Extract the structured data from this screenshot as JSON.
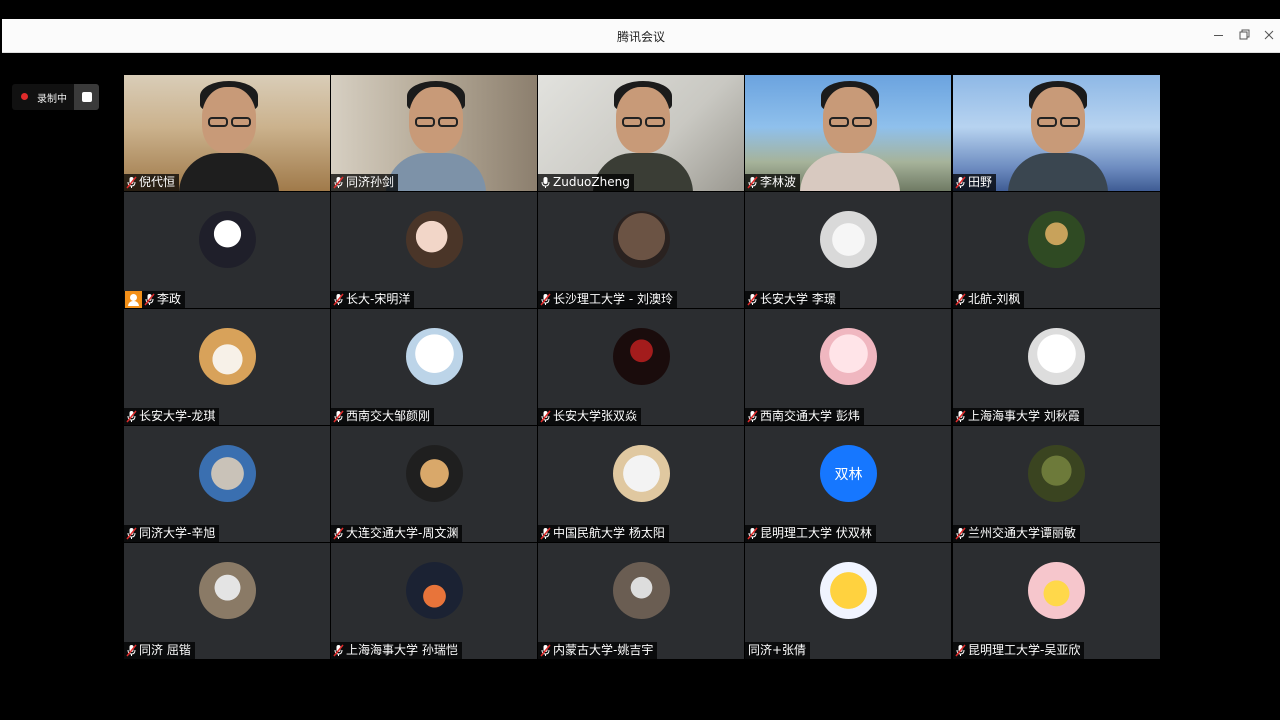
{
  "window": {
    "title": "腾讯会议",
    "controls": [
      "minimize-icon",
      "restore-icon",
      "close-icon"
    ]
  },
  "recording": {
    "label": "录制中",
    "stop_icon": "stop-square-icon",
    "status_color": "#e02b2b"
  },
  "participants": [
    {
      "name": "倪代恒",
      "type": "video",
      "muted": true
    },
    {
      "name": "同济孙剑",
      "type": "video",
      "muted": true
    },
    {
      "name": "ZuduoZheng",
      "type": "video",
      "muted": false
    },
    {
      "name": "李林波",
      "type": "video",
      "muted": true
    },
    {
      "name": "田野",
      "type": "video",
      "muted": true
    },
    {
      "name": "李政",
      "type": "avatar",
      "muted": true,
      "host": true
    },
    {
      "name": "长大-宋明洋",
      "type": "avatar",
      "muted": true
    },
    {
      "name": "长沙理工大学 - 刘澳玲",
      "type": "avatar",
      "muted": true
    },
    {
      "name": "长安大学 李璟",
      "type": "avatar",
      "muted": true
    },
    {
      "name": "北航-刘枫",
      "type": "avatar",
      "muted": true
    },
    {
      "name": "长安大学-龙琪",
      "type": "avatar",
      "muted": true
    },
    {
      "name": "西南交大邹颜刚",
      "type": "avatar",
      "muted": true
    },
    {
      "name": "长安大学张双焱",
      "type": "avatar",
      "muted": true
    },
    {
      "name": "西南交通大学 彭炜",
      "type": "avatar",
      "muted": true
    },
    {
      "name": "上海海事大学 刘秋霞",
      "type": "avatar",
      "muted": true
    },
    {
      "name": "同济大学-辛旭",
      "type": "avatar",
      "muted": true
    },
    {
      "name": "大连交通大学-周文渊",
      "type": "avatar",
      "muted": true
    },
    {
      "name": "中国民航大学 杨太阳",
      "type": "avatar",
      "muted": true
    },
    {
      "name": "昆明理工大学 伏双林",
      "type": "avatar",
      "muted": true,
      "avatar_text": "双林"
    },
    {
      "name": "兰州交通大学谭丽敏",
      "type": "avatar",
      "muted": true
    },
    {
      "name": "同济 屈锴",
      "type": "avatar",
      "muted": true
    },
    {
      "name": "上海海事大学 孙瑞恺",
      "type": "avatar",
      "muted": true
    },
    {
      "name": "内蒙古大学-姚吉宇",
      "type": "avatar",
      "muted": true
    },
    {
      "name": "同济+张倩",
      "type": "avatar",
      "muted": false,
      "no_mic_icon": true
    },
    {
      "name": "昆明理工大学-吴亚欣",
      "type": "avatar",
      "muted": true
    }
  ],
  "colors": {
    "tile_bg": "#2b2d30",
    "host_badge": "#f39019",
    "mute_red": "#e02b2b"
  }
}
